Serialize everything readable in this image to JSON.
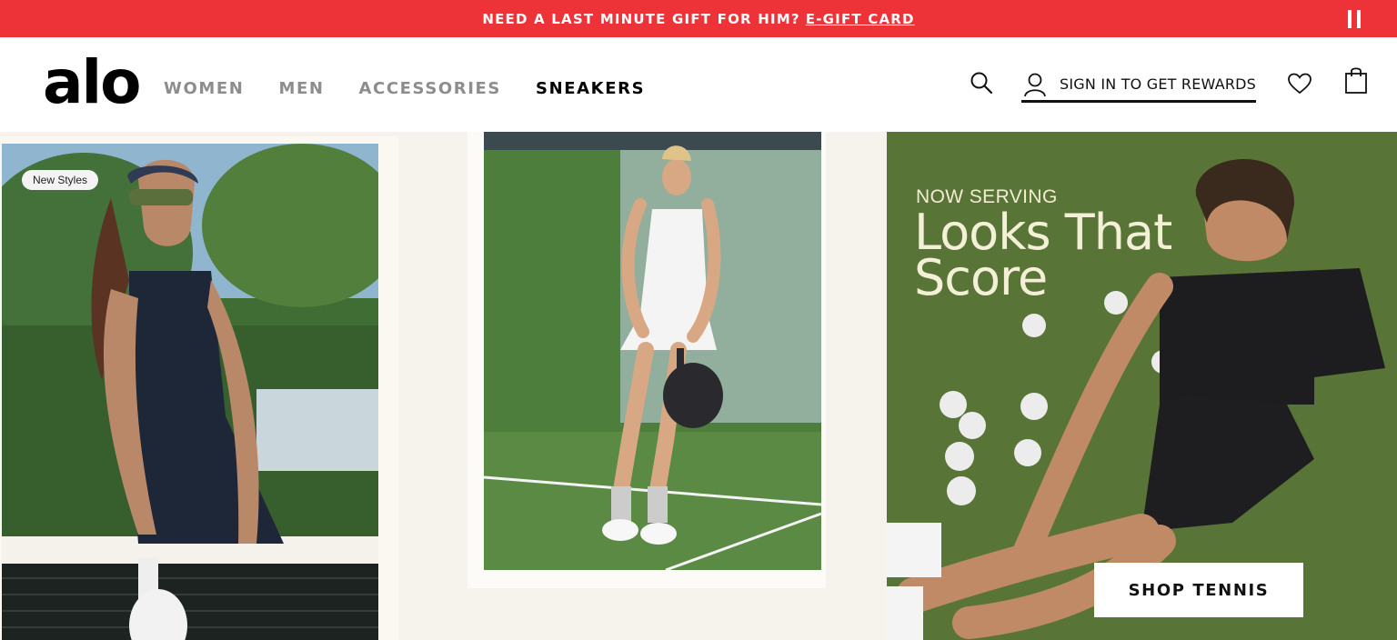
{
  "promo": {
    "text": "NEED A LAST MINUTE GIFT FOR HIM?",
    "link": "E-GIFT CARD"
  },
  "header": {
    "logo": "alo",
    "nav": [
      "WOMEN",
      "MEN",
      "ACCESSORIES",
      "SNEAKERS"
    ],
    "active_nav": "SNEAKERS",
    "signin": "SIGN IN TO GET REWARDS",
    "icons": [
      "search-icon",
      "user-icon",
      "heart-icon",
      "bag-icon",
      "pause-icon"
    ]
  },
  "hero": {
    "badge": "New Styles",
    "eyebrow": "NOW SERVING",
    "headline": "Looks That Score",
    "cta": "SHOP TENNIS"
  },
  "colors": {
    "promo_bg": "#ee3338",
    "nav_inactive": "#8d8d8d",
    "headline": "#f4efd7",
    "court_green": "#5e7a3a"
  }
}
